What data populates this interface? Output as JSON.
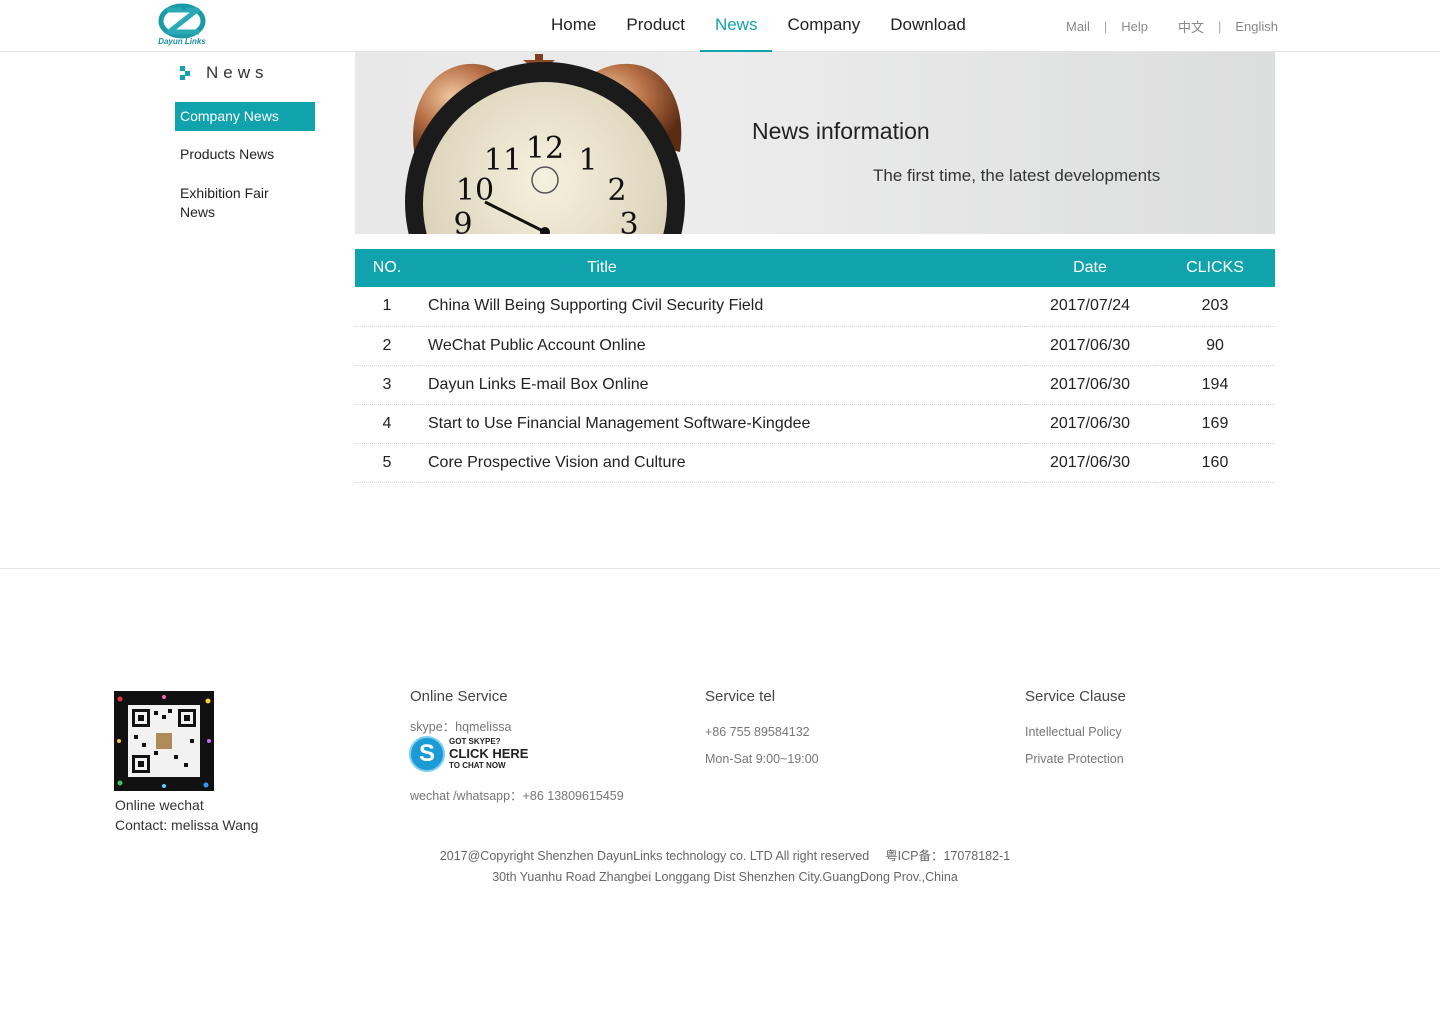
{
  "header": {
    "logo_text": "Dayun Links",
    "nav": [
      "Home",
      "Product",
      "News",
      "Company",
      "Download"
    ],
    "active_nav": "News",
    "top_links": [
      "Mail",
      "Help",
      "中文",
      "English"
    ],
    "separator": "|"
  },
  "sidebar": {
    "title": "News",
    "items": [
      {
        "label": "Company News",
        "active": true
      },
      {
        "label": "Products News",
        "active": false
      },
      {
        "label": "Exhibition Fair News",
        "active": false
      }
    ]
  },
  "banner": {
    "title": "News information",
    "subtitle": "The first time, the latest developments"
  },
  "table": {
    "headers": {
      "no": "NO.",
      "title": "Title",
      "date": "Date",
      "clicks": "CLICKS"
    },
    "rows": [
      {
        "no": "1",
        "title": "China Will Being Supporting Civil Security Field",
        "date": "2017/07/24",
        "clicks": "203"
      },
      {
        "no": "2",
        "title": "WeChat Public Account Online",
        "date": "2017/06/30",
        "clicks": "90"
      },
      {
        "no": "3",
        "title": "Dayun Links E-mail Box Online",
        "date": "2017/06/30",
        "clicks": "194"
      },
      {
        "no": "4",
        "title": "Start to Use Financial Management Software-Kingdee",
        "date": "2017/06/30",
        "clicks": "169"
      },
      {
        "no": "5",
        "title": "Core Prospective Vision and Culture",
        "date": "2017/06/30",
        "clicks": "160"
      }
    ]
  },
  "footer": {
    "qr_caption_1": "Online wechat",
    "qr_caption_2": "Contact: melissa Wang",
    "online_service": {
      "title": "Online Service",
      "skype": "skype：hqmelissa",
      "skype_btn_1": "GOT SKYPE?",
      "skype_btn_2": "CLICK HERE",
      "skype_btn_3": "TO CHAT NOW",
      "wechat": "wechat /whatsapp：+86 13809615459"
    },
    "service_tel": {
      "title": "Service tel",
      "phone": "+86 755 89584132",
      "hours": "Mon-Sat 9:00~19:00"
    },
    "service_clause": {
      "title": "Service Clause",
      "items": [
        "Intellectual Policy",
        "Private Protection"
      ]
    },
    "copyright_1": "2017@Copyright Shenzhen DayunLinks technology co. LTD All right reserved　 粤ICP备：17078182-1",
    "copyright_2": "30th Yuanhu Road Zhangbei Longgang Dist Shenzhen City.GuangDong Prov.,China"
  },
  "colors": {
    "accent": "#11a3ad"
  }
}
